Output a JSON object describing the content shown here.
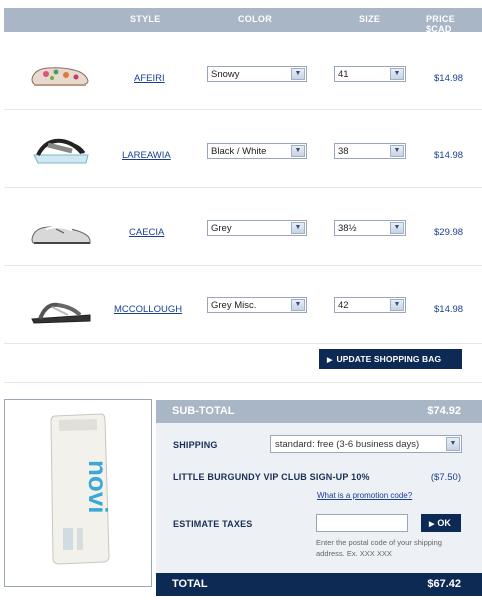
{
  "header": {
    "style": "STYLE",
    "color": "COLOR",
    "size": "SIZE",
    "price": "PRICE $CAD"
  },
  "items": [
    {
      "style": "AFEIRI",
      "color": "Snowy",
      "size": "41",
      "price": "$14.98",
      "thumb_icon": "floral-loafer-shoe-icon"
    },
    {
      "style": "LAREAWIA",
      "color": "Black / White",
      "size": "38",
      "price": "$14.98",
      "thumb_icon": "platform-sandal-icon"
    },
    {
      "style": "CAECIA",
      "color": "Grey",
      "size": "38½",
      "price": "$29.98",
      "thumb_icon": "boat-shoe-icon"
    },
    {
      "style": "MCCOLLOUGH",
      "color": "Grey Misc.",
      "size": "42",
      "price": "$14.98",
      "thumb_icon": "sport-sandal-icon"
    }
  ],
  "update_button": "UPDATE SHOPPING BAG",
  "promo": {
    "product_brand": "novi"
  },
  "summary": {
    "subtotal_label": "SUB-TOTAL",
    "subtotal_value": "$74.92",
    "shipping_label": "SHIPPING",
    "shipping_option": "standard: free (3-6 business days)",
    "vip_label": "LITTLE BURGUNDY VIP CLUB SIGN-UP 10%",
    "vip_value": "($7.50)",
    "promo_link": "What is a promotion code?",
    "taxes_label": "ESTIMATE TAXES",
    "postal_placeholder": "",
    "ok_label": "OK",
    "help_text": "Enter the postal code of your shipping address.  Ex. XXX XXX",
    "total_label": "TOTAL",
    "total_value": "$67.42"
  },
  "colors": {
    "header_bar": "#a9b6c6",
    "dark_navy": "#0c2a54",
    "link_blue": "#1a3f91",
    "summary_bg": "#edf0f4"
  }
}
